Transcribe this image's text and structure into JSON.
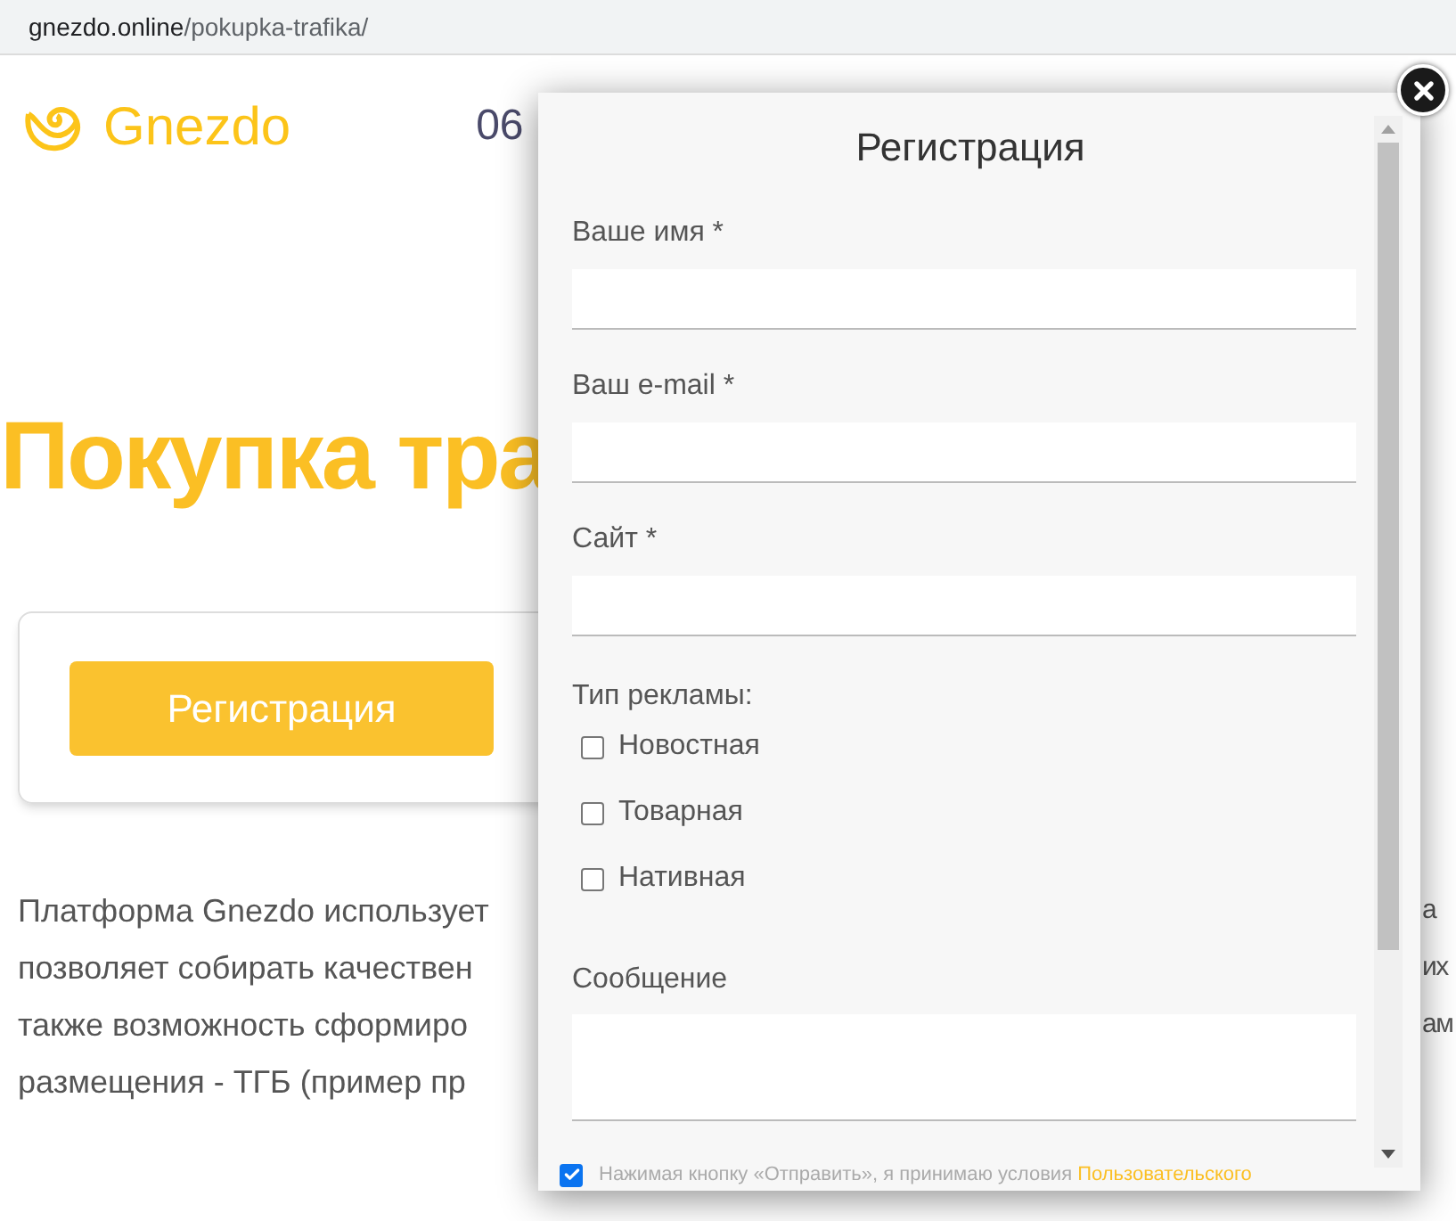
{
  "browser": {
    "url_host": "gnezdo.online",
    "url_path": "/pokupka-trafika/"
  },
  "page": {
    "logo": "Gnezdo",
    "nav_fragment": "06",
    "heading": "Покупка тра",
    "button": "Регистрация",
    "paragraph_lines": [
      {
        "text": "Платформа Gnezdo использует",
        "fragment": "а"
      },
      {
        "text": "позволяет собирать качествен",
        "fragment": "их"
      },
      {
        "text": "также возможность сформиро",
        "fragment": "ам"
      },
      {
        "text": "размещения - ТГБ (пример пр"
      }
    ]
  },
  "modal": {
    "title": "Регистрация",
    "fields": [
      {
        "label": "Ваше имя *"
      },
      {
        "label": "Ваш e-mail *"
      },
      {
        "label": "Сайт *"
      }
    ],
    "ad_type": {
      "label": "Тип рекламы:",
      "options": [
        {
          "label": "Новостная",
          "checked": false
        },
        {
          "label": "Товарная",
          "checked": false
        },
        {
          "label": "Нативная",
          "checked": false
        }
      ]
    },
    "message": {
      "label": "Сообщение"
    },
    "consent": {
      "text": "Нажимая кнопку «Отправить», я принимаю условия",
      "link": "Пользовательского",
      "checked": true
    }
  }
}
